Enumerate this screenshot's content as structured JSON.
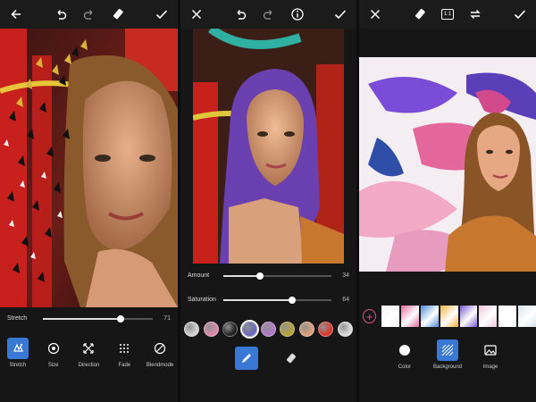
{
  "panel1": {
    "slider": {
      "label": "Stretch",
      "value": "71",
      "fraction": 0.71
    },
    "tools": [
      {
        "label": "Stretch",
        "icon": "stretch-icon",
        "active": true
      },
      {
        "label": "Size",
        "icon": "size-icon",
        "active": false
      },
      {
        "label": "Direction",
        "icon": "direction-icon",
        "active": false
      },
      {
        "label": "Fade",
        "icon": "fade-icon",
        "active": false
      },
      {
        "label": "Blendmode",
        "icon": "blendmode-icon",
        "active": false
      }
    ]
  },
  "panel2": {
    "sliders": [
      {
        "label": "Amount",
        "value": "34",
        "fraction": 0.34
      },
      {
        "label": "Saturation",
        "value": "64",
        "fraction": 0.64
      }
    ],
    "swatch_colors": [
      "#cfcfcf",
      "#d98aa8",
      "#222222",
      "#6a6ab8",
      "#b278c8",
      "#b5a23a",
      "#d9a07c",
      "#d83a2e",
      "#d8d8d8"
    ],
    "selected_swatch": 3
  },
  "panel3": {
    "top_badge": "1:1",
    "thumb_colors": [
      "#f3f3f3",
      "#e36a9d",
      "#4a8bd9",
      "#f0b23a",
      "#7a5ad0",
      "#f2c7d9",
      "#ffffff",
      "#d8e4ee"
    ],
    "tabs": [
      {
        "label": "Color",
        "icon": "color-circle-icon",
        "active": false
      },
      {
        "label": "Background",
        "icon": "background-pattern-icon",
        "active": true
      },
      {
        "label": "Image",
        "icon": "image-icon",
        "active": false
      }
    ]
  },
  "colors": {
    "accent": "#3a78d6",
    "pink_accent": "#e04c8a"
  }
}
